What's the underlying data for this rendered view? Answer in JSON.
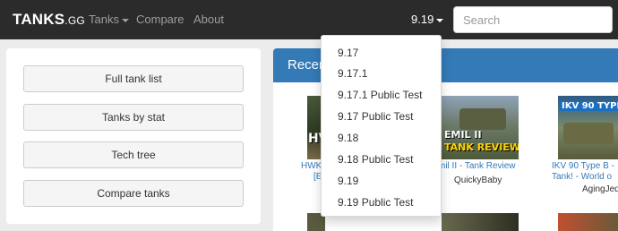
{
  "navbar": {
    "brand_main": "TANKS",
    "brand_suffix": ".GG",
    "tanks_label": "Tanks",
    "compare_label": "Compare",
    "about_label": "About",
    "version_label": "9.19",
    "search_placeholder": "Search"
  },
  "sidebar": {
    "buttons": [
      "Full tank list",
      "Tanks by stat",
      "Tech tree",
      "Compare tanks"
    ]
  },
  "recent": {
    "title": "Recen",
    "videos": [
      {
        "thumb_text": "HV",
        "title_line1": "HWK",
        "title_line2": "[E",
        "channel": ""
      },
      {
        "thumb_text": "EMIL II",
        "thumb_text2": "TANK REVIEW",
        "title_line1": "mil II - Tank Review",
        "channel": "QuickyBaby"
      },
      {
        "thumb_text": "IKV 90 TYPE",
        "title_line1": "IKV 90 Type B -",
        "title_line2": "Tank! - World o",
        "channel": "AgingJed"
      }
    ]
  },
  "version_dropdown": {
    "items": [
      "9.17",
      "9.17.1",
      "9.17.1 Public Test",
      "9.17 Public Test",
      "9.18",
      "9.18 Public Test",
      "9.19",
      "9.19 Public Test"
    ]
  },
  "colors": {
    "navbar_bg": "#2b2b2b",
    "panel_header": "#337ab7",
    "link": "#337ab7"
  }
}
